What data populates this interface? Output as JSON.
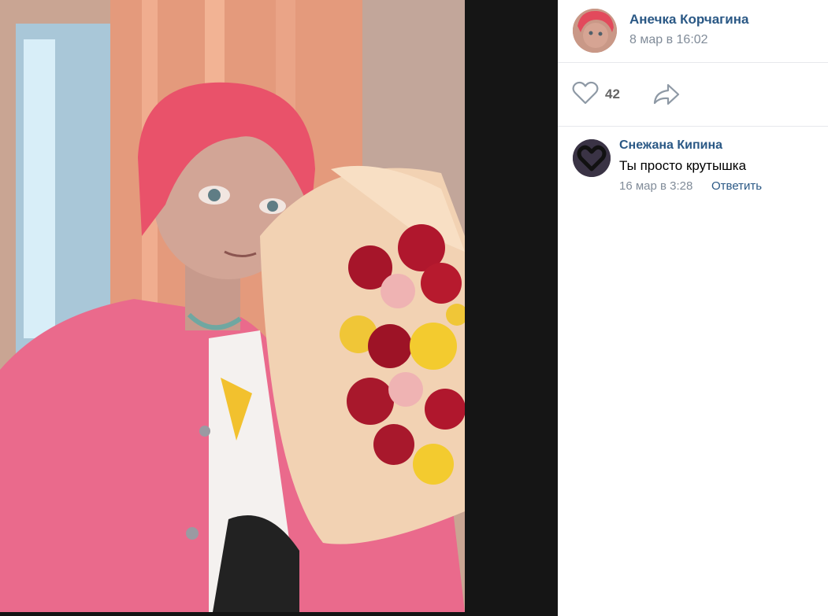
{
  "post": {
    "author": "Анечка Корчагина",
    "date": "8 мар в 16:02",
    "likes": "42"
  },
  "comments": [
    {
      "author": "Снежана Кипина",
      "text": "Ты просто крутышка",
      "date": "16 мар в 3:28",
      "reply_label": "Ответить"
    }
  ],
  "icons": {
    "like": "heart-icon",
    "share": "share-arrow-icon"
  },
  "colors": {
    "link": "#2a5885",
    "secondary_text": "#818c99",
    "divider": "#e7e8ec",
    "viewer_bg": "#141414"
  }
}
